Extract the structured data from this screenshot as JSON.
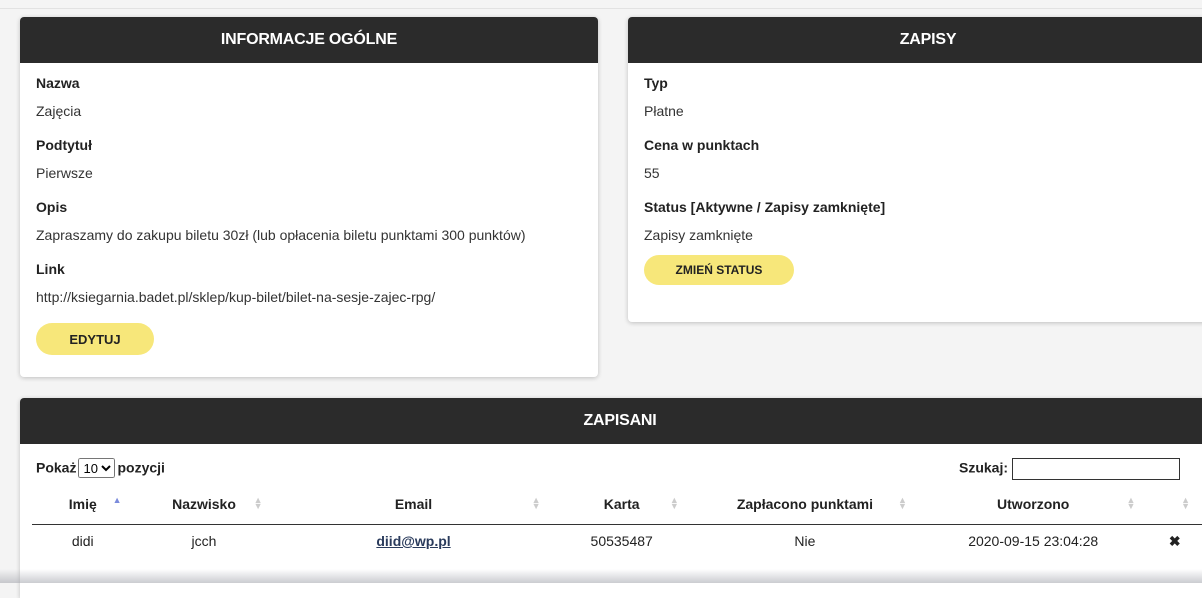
{
  "info": {
    "title": "INFORMACJE OGÓLNE",
    "fields": [
      {
        "label": "Nazwa",
        "value": "Zajęcia"
      },
      {
        "label": "Podtytuł",
        "value": "Pierwsze"
      },
      {
        "label": "Opis",
        "value": "Zapraszamy do zakupu biletu 30zł (lub opłacenia biletu punktami 300 punktów)"
      },
      {
        "label": "Link",
        "value": "http://ksiegarnia.badet.pl/sklep/kup-bilet/bilet-na-sesje-zajec-rpg/"
      }
    ],
    "edit_label": "EDYTUJ"
  },
  "zapisy": {
    "title": "ZAPISY",
    "fields": [
      {
        "label": "Typ",
        "value": "Płatne"
      },
      {
        "label": "Cena w punktach",
        "value": "55"
      },
      {
        "label": "Status [Aktywne / Zapisy zamknięte]",
        "value": "Zapisy zamknięte"
      }
    ],
    "change_status_label": "ZMIEŃ STATUS"
  },
  "zapisani": {
    "title": "ZAPISANI",
    "show_prefix": "Pokaż",
    "show_value": "10",
    "show_suffix": "pozycji",
    "search_label": "Szukaj:",
    "search_value": "",
    "columns": [
      "Imię",
      "Nazwisko",
      "Email",
      "Karta",
      "Zapłacono punktami",
      "Utworzono",
      ""
    ],
    "sorted_column": "Imię",
    "sort_direction": "ascending",
    "rows": [
      {
        "imie": "didi",
        "nazwisko": "jcch",
        "email": "diid@wp.pl",
        "karta": "50535487",
        "punkty": "Nie",
        "utworzono": "2020-09-15 23:04:28"
      }
    ]
  }
}
